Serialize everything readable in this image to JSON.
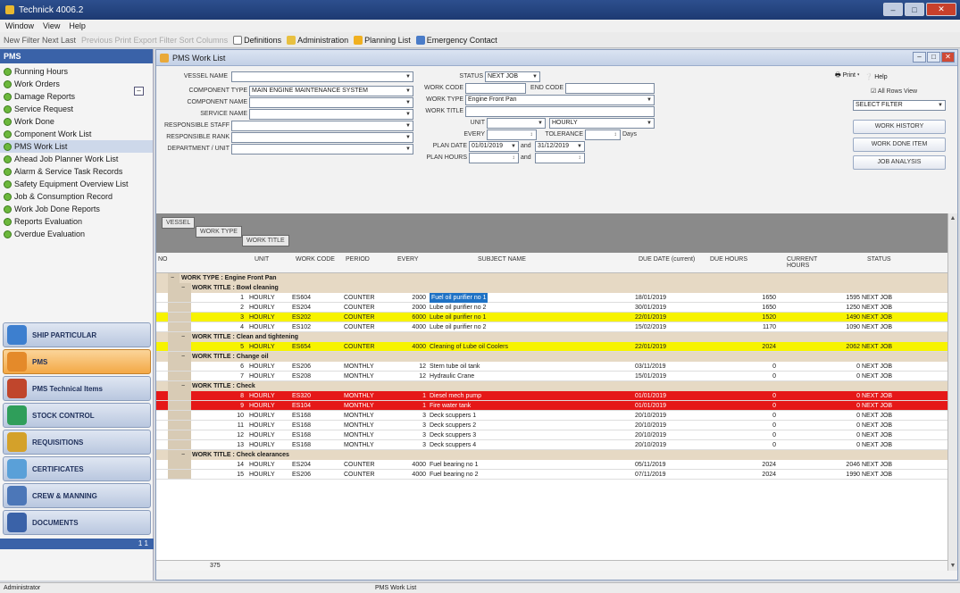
{
  "window": {
    "title": "Technick 4006.2"
  },
  "menu": [
    "Window",
    "View",
    "Help"
  ],
  "toolbar": {
    "left_text": "New  Filter  Next  Last",
    "dim_text": "Previous  Print  Export  Filter  Sort  Columns",
    "buttons": [
      "Definitions",
      "Administration",
      "Planning List",
      "Emergency Contact"
    ]
  },
  "sidebar": {
    "header": "PMS",
    "items": [
      "Running Hours",
      "Work Orders",
      "Damage Reports",
      "Service Request",
      "Work Done",
      "Component Work List",
      "PMS Work List",
      "Ahead Job Planner Work List",
      "Alarm & Service Task Records",
      "Safety Equipment Overview List",
      "Job & Consumption Record",
      "Work Job Done Reports",
      "Reports Evaluation",
      "Overdue Evaluation"
    ],
    "selected_index": 6,
    "modules": [
      "SHIP PARTICULAR",
      "PMS",
      "PMS Technical Items",
      "STOCK CONTROL",
      "REQUISITIONS",
      "CERTIFICATES",
      "CREW & MANNING",
      "DOCUMENTS"
    ],
    "active_module": 1,
    "footer": "1 1"
  },
  "main": {
    "title": "PMS Work List",
    "filters": {
      "vessel_name_label": "VESSEL NAME",
      "vessel_name_value": "",
      "component_type_label": "COMPONENT TYPE",
      "component_type_value": "MAIN ENGINE MAINTENANCE SYSTEM",
      "component_label": "COMPONENT NAME",
      "component_value": "",
      "service_label": "SERVICE NAME",
      "service_value": "",
      "responsible_label": "RESPONSIBLE STAFF",
      "responsible_value": "",
      "responsible_rank_label": "RESPONSIBLE RANK",
      "responsible_rank_value": "",
      "department_label": "DEPARTMENT / UNIT",
      "department_value": "",
      "status_label": "STATUS",
      "status_value": "NEXT JOB",
      "work_code_label": "WORK CODE",
      "work_code_value": "",
      "end_code_label": "END CODE",
      "end_code_value": "",
      "work_type_label": "WORK TYPE",
      "work_type_value": "Engine Front Pan",
      "work_title_label": "WORK TITLE",
      "work_title_value": "",
      "unit_label": "UNIT",
      "unit_value": "",
      "unit2_value": "HOURLY",
      "every_label": "EVERY",
      "every_value": "",
      "tolerance_label": "TOLERANCE",
      "tolerance_value": "",
      "tolerance_unit": "Days",
      "plan_date_label": "PLAN DATE",
      "plan_date_from": "01/01/2019",
      "plan_date_and": "and",
      "plan_date_to": "31/12/2019",
      "plan_hours_label": "PLAN HOURS",
      "plan_hours_and": "and"
    },
    "right_panel": {
      "print_label": "Print",
      "help_label": "Help",
      "all_rows_label": "All Rows View",
      "select_filter_label": "SELECT FILTER",
      "work_history_label": "WORK HISTORY",
      "work_done_label": "WORK DONE ITEM",
      "job_analysis_label": "JOB ANALYSIS"
    },
    "group_chips": [
      "VESSEL",
      "WORK TYPE",
      "WORK TITLE"
    ],
    "columns": [
      "NO",
      "UNIT",
      "WORK CODE",
      "PERIOD",
      "EVERY",
      "SUBJECT NAME",
      "DUE DATE (current)",
      "DUE HOURS",
      "CURRENT HOURS",
      "STATUS"
    ],
    "vessel_group": "VESSEL : ",
    "groups": [
      {
        "type": "WORK TYPE : Engine Front Pan",
        "title": "WORK TITLE : Bowl cleaning",
        "rows": [
          {
            "no": "1",
            "unit": "HOURLY",
            "code": "ES604",
            "period": "COUNTER",
            "every": "2000",
            "subject": "Fuel oil purifier no 1",
            "due": "18/01/2019",
            "dh": "1650",
            "ch": "1595",
            "status": "NEXT JOB",
            "style": "sel"
          },
          {
            "no": "2",
            "unit": "HOURLY",
            "code": "ES204",
            "period": "COUNTER",
            "every": "2000",
            "subject": "Lube oil purifier no 2",
            "due": "30/01/2019",
            "dh": "1650",
            "ch": "1250",
            "status": "NEXT JOB",
            "style": ""
          },
          {
            "no": "3",
            "unit": "HOURLY",
            "code": "ES202",
            "period": "COUNTER",
            "every": "6000",
            "subject": "Lube oil purifier no 1",
            "due": "22/01/2019",
            "dh": "1520",
            "ch": "1490",
            "status": "NEXT JOB",
            "style": "yellow"
          },
          {
            "no": "4",
            "unit": "HOURLY",
            "code": "ES102",
            "period": "COUNTER",
            "every": "4000",
            "subject": "Lube oil purifier no 2",
            "due": "15/02/2019",
            "dh": "1170",
            "ch": "1090",
            "status": "NEXT JOB",
            "style": ""
          }
        ]
      },
      {
        "type": "",
        "title": "WORK TITLE : Clean and tightening",
        "rows": [
          {
            "no": "5",
            "unit": "HOURLY",
            "code": "ES654",
            "period": "COUNTER",
            "every": "4000",
            "subject": "Cleaning of Lube oil Coolers",
            "due": "22/01/2019",
            "dh": "2024",
            "ch": "2062",
            "status": "NEXT JOB",
            "style": "yellow"
          }
        ]
      },
      {
        "type": "",
        "title": "WORK TITLE : Change oil",
        "rows": [
          {
            "no": "6",
            "unit": "HOURLY",
            "code": "ES206",
            "period": "MONTHLY",
            "every": "12",
            "subject": "Stern tube oil tank",
            "due": "03/11/2019",
            "dh": "0",
            "ch": "0",
            "status": "NEXT JOB",
            "style": ""
          },
          {
            "no": "7",
            "unit": "HOURLY",
            "code": "ES208",
            "period": "MONTHLY",
            "every": "12",
            "subject": "Hydraulic Crane",
            "due": "15/01/2019",
            "dh": "0",
            "ch": "0",
            "status": "NEXT JOB",
            "style": ""
          }
        ]
      },
      {
        "type": "",
        "title": "WORK TITLE : Check",
        "rows": [
          {
            "no": "8",
            "unit": "HOURLY",
            "code": "ES320",
            "period": "MONTHLY",
            "every": "1",
            "subject": "Diesel mech pump",
            "due": "01/01/2019",
            "dh": "0",
            "ch": "0",
            "status": "NEXT JOB",
            "style": "red"
          },
          {
            "no": "9",
            "unit": "HOURLY",
            "code": "ES104",
            "period": "MONTHLY",
            "every": "1",
            "subject": "Fire water tank",
            "due": "01/01/2019",
            "dh": "0",
            "ch": "0",
            "status": "NEXT JOB",
            "style": "red"
          },
          {
            "no": "10",
            "unit": "HOURLY",
            "code": "ES168",
            "period": "MONTHLY",
            "every": "3",
            "subject": "Deck scuppers 1",
            "due": "20/10/2019",
            "dh": "0",
            "ch": "0",
            "status": "NEXT JOB",
            "style": ""
          },
          {
            "no": "11",
            "unit": "HOURLY",
            "code": "ES168",
            "period": "MONTHLY",
            "every": "3",
            "subject": "Deck scuppers 2",
            "due": "20/10/2019",
            "dh": "0",
            "ch": "0",
            "status": "NEXT JOB",
            "style": ""
          },
          {
            "no": "12",
            "unit": "HOURLY",
            "code": "ES168",
            "period": "MONTHLY",
            "every": "3",
            "subject": "Deck scuppers 3",
            "due": "20/10/2019",
            "dh": "0",
            "ch": "0",
            "status": "NEXT JOB",
            "style": ""
          },
          {
            "no": "13",
            "unit": "HOURLY",
            "code": "ES168",
            "period": "MONTHLY",
            "every": "3",
            "subject": "Deck scuppers 4",
            "due": "20/10/2019",
            "dh": "0",
            "ch": "0",
            "status": "NEXT JOB",
            "style": ""
          }
        ]
      },
      {
        "type": "",
        "title": "WORK TITLE : Check clearances",
        "rows": [
          {
            "no": "14",
            "unit": "HOURLY",
            "code": "ES204",
            "period": "COUNTER",
            "every": "4000",
            "subject": "Fuel bearing no 1",
            "due": "05/11/2019",
            "dh": "2024",
            "ch": "2046",
            "status": "NEXT JOB",
            "style": ""
          },
          {
            "no": "15",
            "unit": "HOURLY",
            "code": "ES206",
            "period": "COUNTER",
            "every": "4000",
            "subject": "Fuel bearing no 2",
            "due": "07/11/2019",
            "dh": "2024",
            "ch": "1990",
            "status": "NEXT JOB",
            "style": ""
          }
        ]
      }
    ],
    "footer_count": "375"
  },
  "statusbar": {
    "left": "Administrator",
    "center": "PMS Work List"
  }
}
